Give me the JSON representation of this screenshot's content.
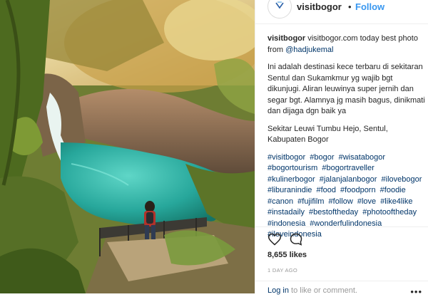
{
  "header": {
    "username": "visitbogor",
    "separator": "•",
    "follow_label": "Follow",
    "avatar_icon": "visitbogor-logo-icon"
  },
  "caption": {
    "username": "visitbogor",
    "line1": "visitbogor.com today best photo from",
    "mention": "@hadjukemal",
    "paragraph1": "Ini adalah destinasi kece terbaru di sekitaran Sentul dan Sukamkmur yg wajib bgt dikunjugi. Aliran leuwinya super jernih dan segar bgt. Alamnya jg masih bagus, dinikmati dan dijaga dgn baik ya",
    "paragraph2": "Sekitar Leuwi Tumbu Hejo, Sentul, Kabupaten Bogor",
    "hashtags": [
      "#visitbogor",
      "#bogor",
      "#wisatabogor",
      "#bogortourism",
      "#bogortraveller",
      "#kulinerbogor",
      "#jalanjalanbogor",
      "#ilovebogor",
      "#liburanindie",
      "#food",
      "#foodporn",
      "#foodie",
      "#canon",
      "#fujifilm",
      "#follow",
      "#love",
      "#like4like",
      "#instadaily",
      "#bestoftheday",
      "#photooftheday",
      "#indonesia",
      "#wonderfulindonesia",
      "#iloveindonesia"
    ]
  },
  "actions": {
    "like_icon": "heart-icon",
    "comment_icon": "comment-icon"
  },
  "likes_text": "8,655 likes",
  "time_ago": "1 DAY AGO",
  "footer": {
    "login_link": "Log in",
    "login_rest": "to like or comment.",
    "more_label": "•••"
  },
  "photo": {
    "description_icon": "post-photo",
    "colors": {
      "water": "#2fb3a6",
      "rock": "#8a6f55",
      "foliage": "#5f7d2c",
      "sky": "#f3e7b0"
    }
  }
}
